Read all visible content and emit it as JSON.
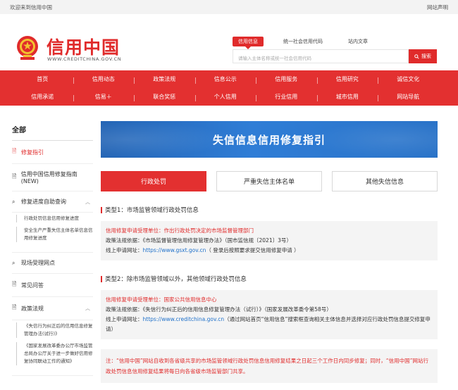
{
  "topbar": {
    "welcome": "欢迎来到信用中国",
    "statement": "网站声明"
  },
  "logo": {
    "name": "信用中国",
    "domain": "WWW.CREDITCHINA.GOV.CN"
  },
  "search": {
    "tabs": [
      "信用信息",
      "统一社会信用代码",
      "站内文章"
    ],
    "placeholder": "请输入主体名称或统一社会信用代码",
    "button": "搜索"
  },
  "nav": {
    "row1": [
      "首页",
      "信用动态",
      "政策法规",
      "信息公示",
      "信用服务",
      "信用研究",
      "诚信文化"
    ],
    "row2": [
      "信用承诺",
      "信易＋",
      "联合奖惩",
      "个人信用",
      "行业信用",
      "城市信用",
      "网站导航"
    ]
  },
  "sidebar": {
    "title": "全部",
    "items": [
      {
        "label": "修复指引"
      },
      {
        "label": "信用中国信用修复指南(NEW)"
      },
      {
        "label": "修复进度自助查询"
      },
      {
        "label": "现场受理网点"
      },
      {
        "label": "常见问答"
      },
      {
        "label": "政策法规"
      }
    ],
    "progress_sub": [
      "行政处罚信息信用修复进度",
      "安全生产严重失信主体名单信息信用修复进度"
    ],
    "policy_sub": [
      "《失信行为纠正后的信用信息修复管理办法(试行)》",
      "《国家发展改革委办公厅市场监管总局办公厅关于进一步做好信用修复协同联动工作的通知》"
    ]
  },
  "main": {
    "banner": "失信信息信用修复指引",
    "tabs": [
      "行政处罚",
      "严重失信主体名单",
      "其他失信信息"
    ],
    "type1": {
      "title": "类型1：市场监管领域行政处罚信息",
      "unit": "信用修复申请受理单位：作出行政处罚决定的市场监督管理部门",
      "basis": "政策法规依据：《市场监督管理信用修复管理办法》（国市监信规〔2021〕3号）",
      "online_prefix": "线上申请网址：",
      "online_url": "https://www.gsxt.gov.cn",
      "online_suffix": "（ 登录后按照要求提交信用修复申请 ）"
    },
    "type2": {
      "title": "类型2：除市场监管领域以外，其他领域行政处罚信息",
      "unit": "信用修复申请受理单位：国家公共信用信息中心",
      "basis": "政策法规依据：《失信行为纠正后的信用信息修复管理办法（试行）》（国家发展改革委令第58号）",
      "online_prefix": "线上申请网址：",
      "online_url": "https://www.creditchina.gov.cn",
      "online_suffix": "（通过网站首页“信用信息”搜索框查询相关主体信息并选择对应行政处罚信息提交修复申请）"
    },
    "note": "注：“信用中国”网站自收到各省级共享的市场监管领域行政处罚信息信用修复结果之日起三个工作日内同步修复；同时，“信用中国”网站行政处罚信息信用修复结果将每日向各省级市场监管部门共享。"
  },
  "colors": {
    "brand_red": "#e33030",
    "banner_blue": "#2a73c8",
    "link_blue": "#1d6fc9"
  }
}
